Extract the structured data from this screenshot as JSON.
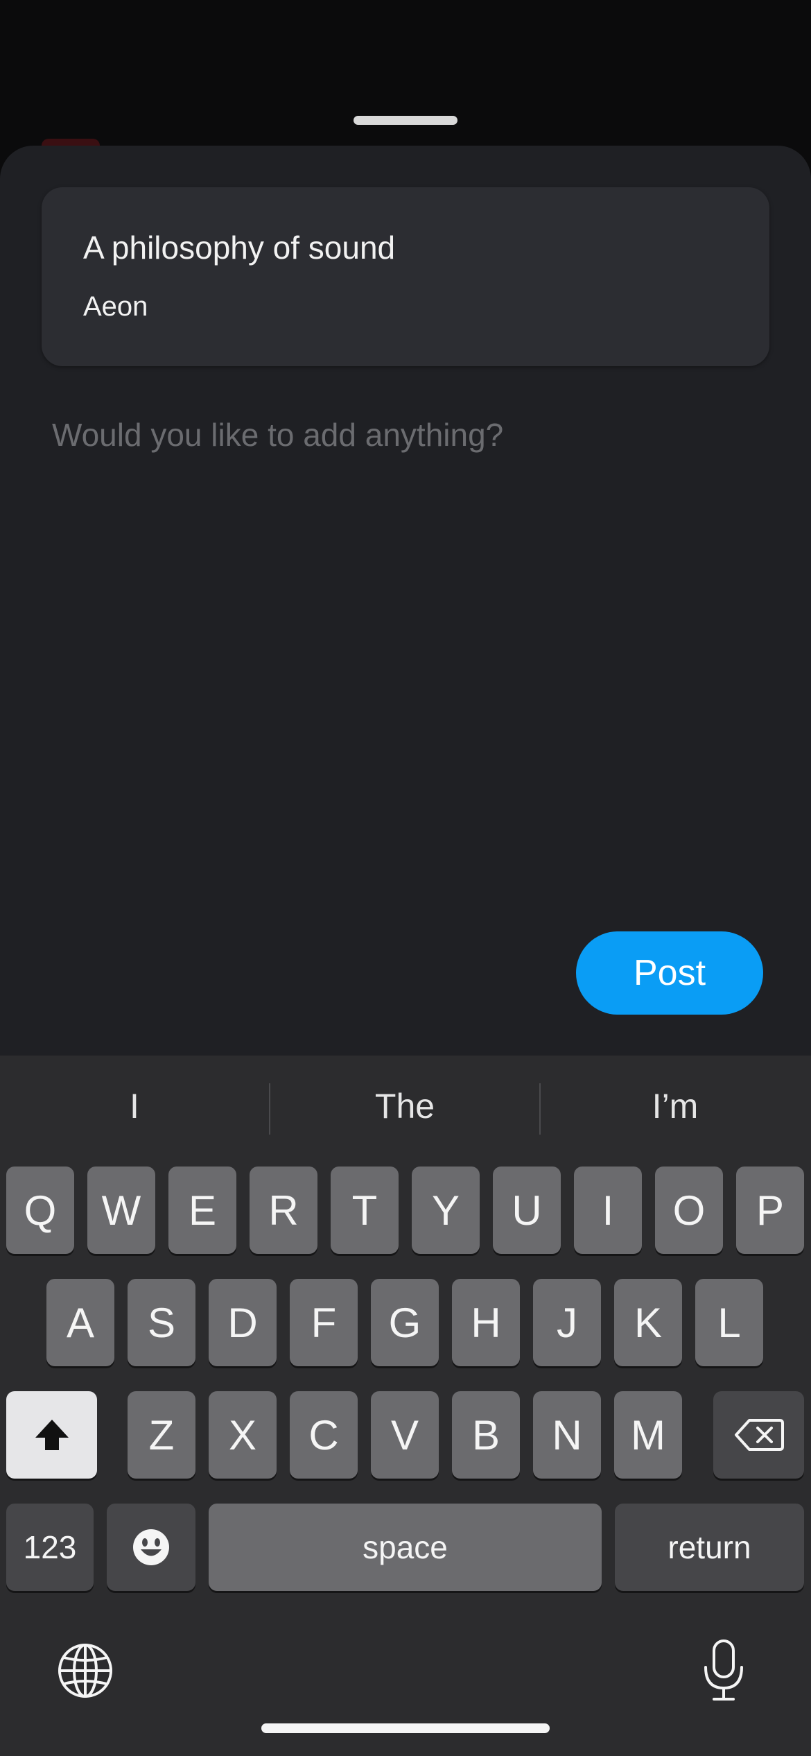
{
  "shared_link": {
    "title": "A philosophy of sound",
    "source": "Aeon"
  },
  "composer": {
    "placeholder": "Would you like to add anything?",
    "post_label": "Post",
    "post_color": "#0a9df5"
  },
  "keyboard": {
    "suggestions": [
      "I",
      "The",
      "I’m"
    ],
    "row1": [
      "Q",
      "W",
      "E",
      "R",
      "T",
      "Y",
      "U",
      "I",
      "O",
      "P"
    ],
    "row2": [
      "A",
      "S",
      "D",
      "F",
      "G",
      "H",
      "J",
      "K",
      "L"
    ],
    "row3": [
      "Z",
      "X",
      "C",
      "V",
      "B",
      "N",
      "M"
    ],
    "numbers_label": "123",
    "space_label": "space",
    "return_label": "return",
    "shift_icon": "shift-icon",
    "delete_icon": "backspace-icon",
    "emoji_icon": "emoji-icon",
    "globe_icon": "globe-icon",
    "mic_icon": "microphone-icon"
  }
}
